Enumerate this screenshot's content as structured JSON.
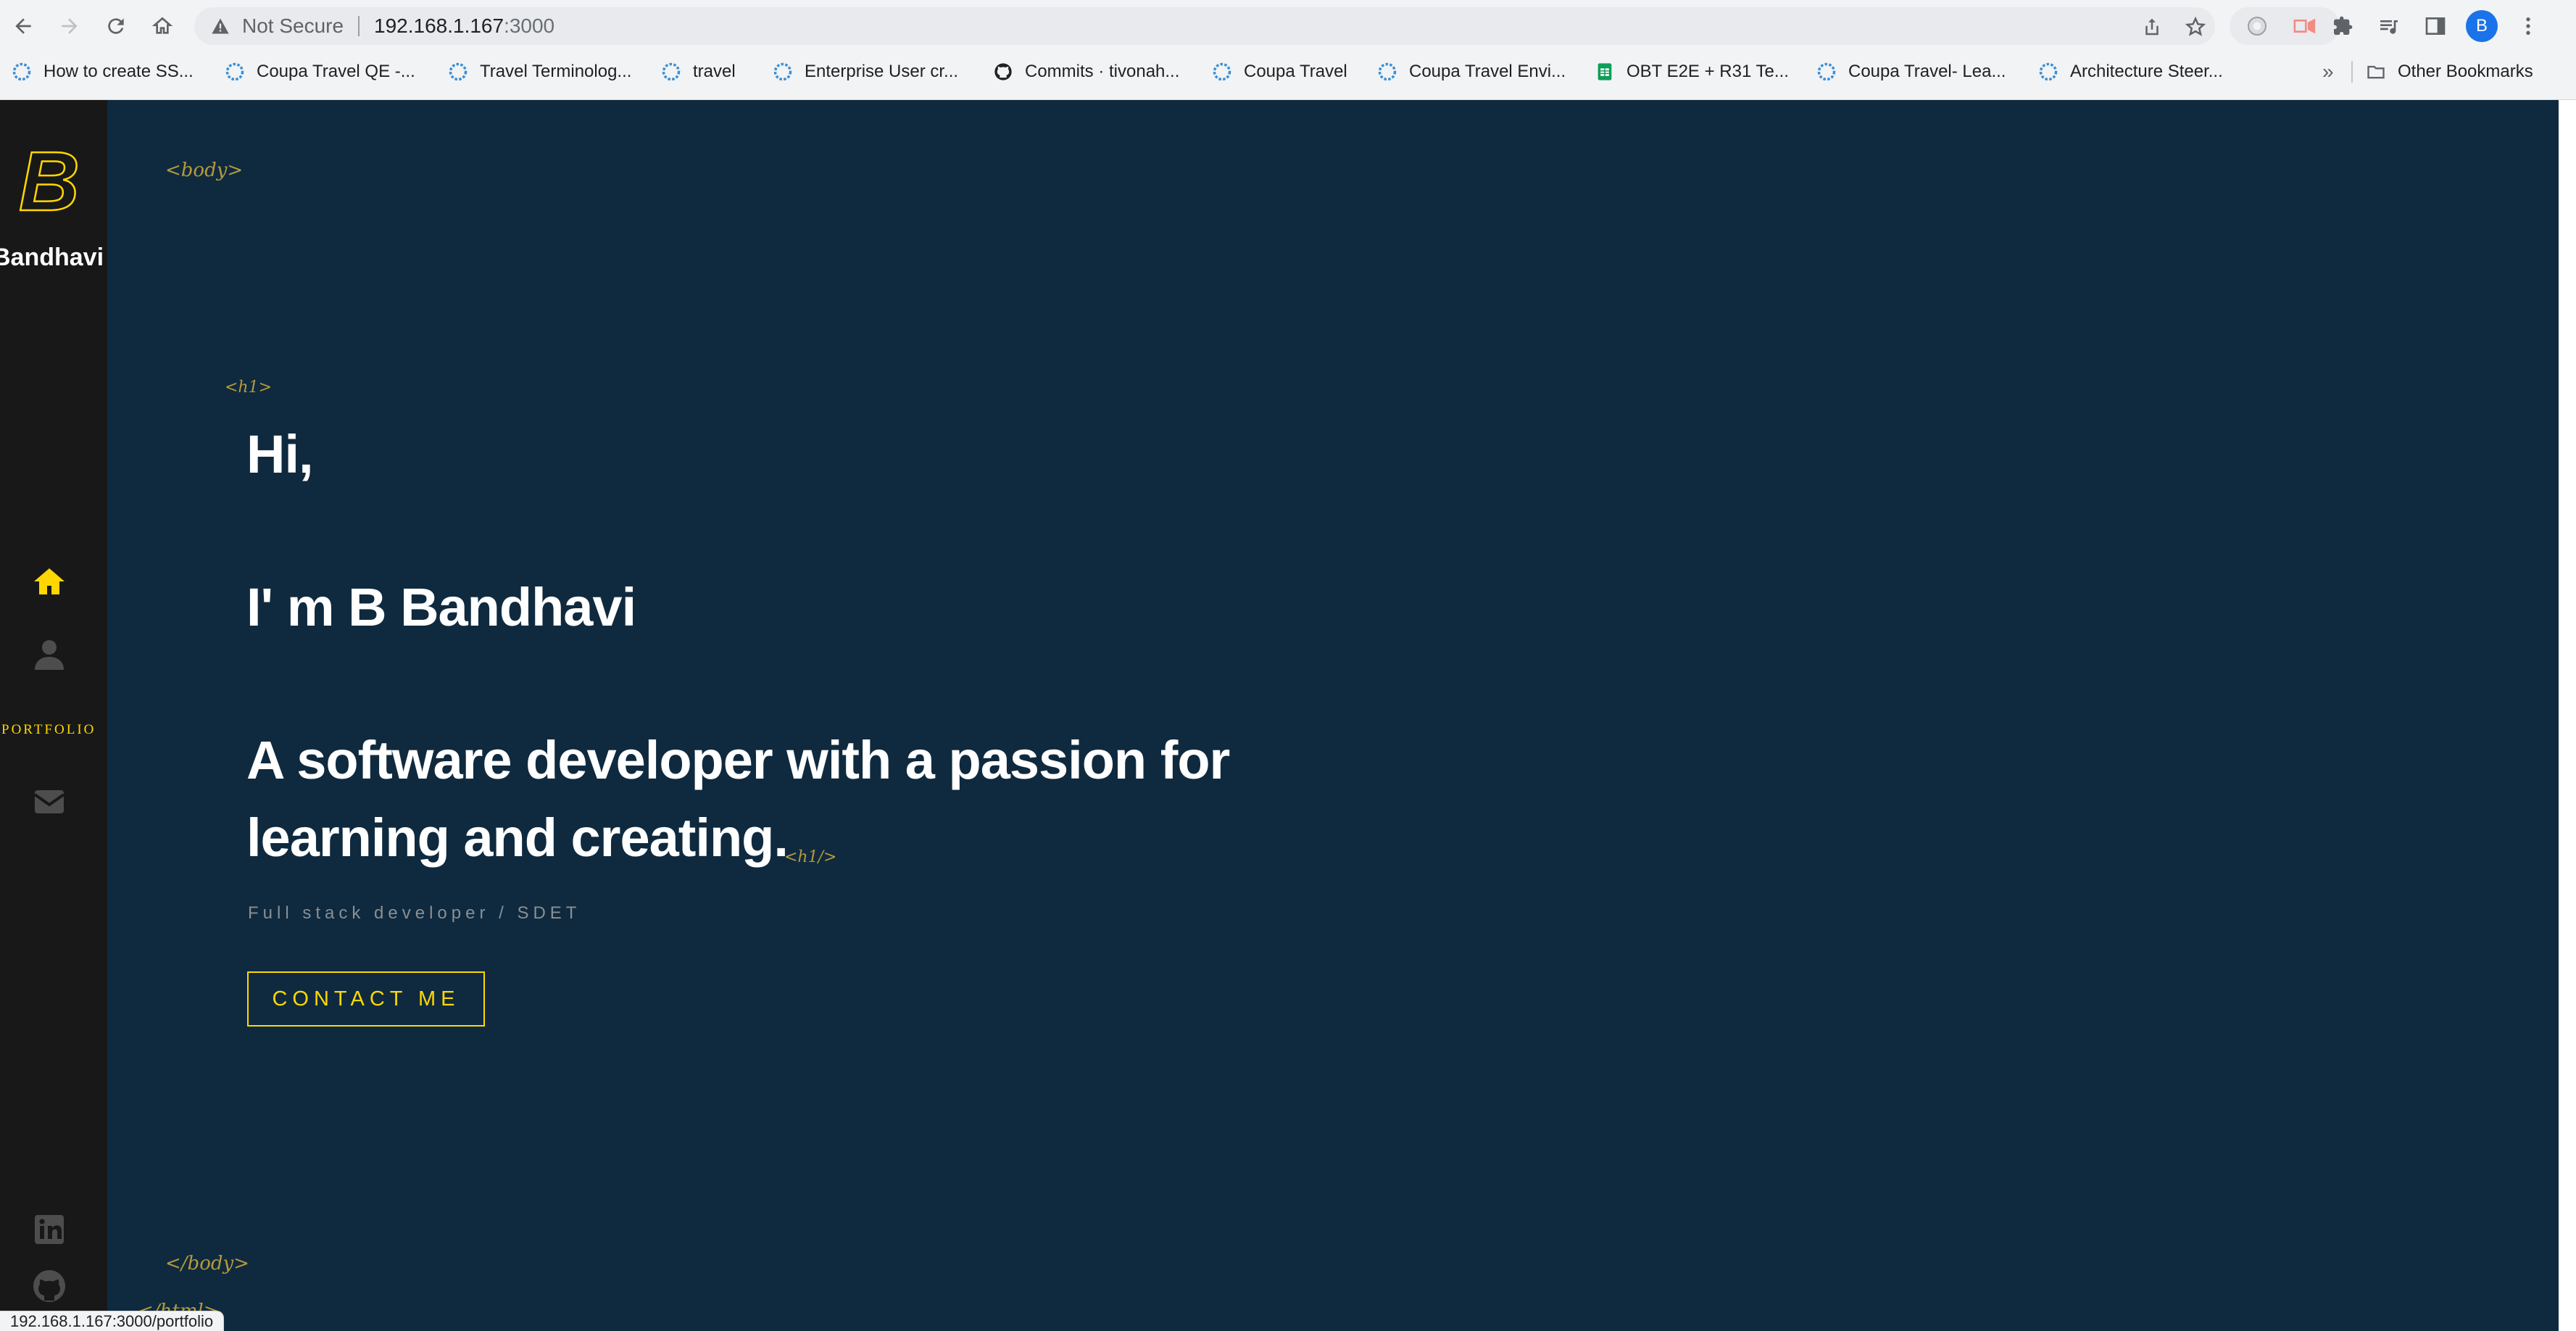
{
  "browser": {
    "security_label": "Not Secure",
    "url_host": "192.168.1.167",
    "url_port": ":3000",
    "profile_initial": "B",
    "status_url": "192.168.1.167:3000/portfolio"
  },
  "bookmarks": {
    "items": [
      {
        "label": "How to create SS..."
      },
      {
        "label": "Coupa Travel QE -..."
      },
      {
        "label": "Travel Terminolog..."
      },
      {
        "label": "travel"
      },
      {
        "label": "Enterprise User cr..."
      },
      {
        "label": "Commits · tivonah..."
      },
      {
        "label": "Coupa Travel"
      },
      {
        "label": "Coupa Travel Envi..."
      },
      {
        "label": "OBT E2E + R31 Te..."
      },
      {
        "label": "Coupa Travel- Lea..."
      },
      {
        "label": "Architecture Steer..."
      }
    ],
    "more": "»",
    "other": "Other Bookmarks"
  },
  "sidebar": {
    "logo_letter": "B",
    "brand": "Bandhavi",
    "portfolio_label": "PORTFOLIO"
  },
  "hero": {
    "body_open": "<body>",
    "h1_open": "<h1>",
    "line1": "Hi,",
    "line2": "I' m B Bandhavi",
    "line3": "A software developer with a passion for",
    "line4": "learning and creating.",
    "h1_close": "<h1/>",
    "subtitle": "Full stack developer / SDET",
    "cta": "CONTACT ME",
    "body_close": "</body>",
    "html_close": "</html>"
  },
  "colors": {
    "accent": "#ffd700",
    "background": "#0f2a3f",
    "sidebar": "#181818"
  }
}
